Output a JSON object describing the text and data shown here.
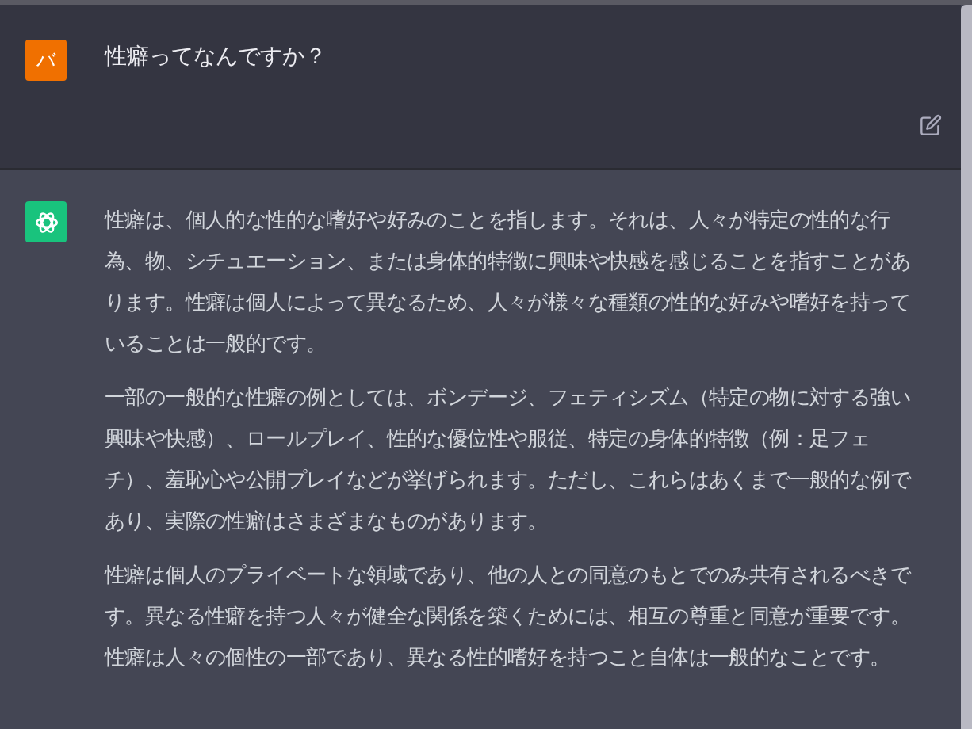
{
  "conversation": [
    {
      "kind": "user",
      "avatar": "バ",
      "text": "性癖ってなんですか？"
    },
    {
      "kind": "assistant",
      "paragraphs": [
        "性癖は、個人的な性的な嗜好や好みのことを指します。それは、人々が特定の性的な行為、物、シチュエーション、または身体的特徴に興味や快感を感じることを指すことがあります。性癖は個人によって異なるため、人々が様々な種類の性的な好みや嗜好を持っていることは一般的です。",
        "一部の一般的な性癖の例としては、ボンデージ、フェティシズム（特定の物に対する強い興味や快感）、ロールプレイ、性的な優位性や服従、特定の身体的特徴（例：足フェチ）、羞恥心や公開プレイなどが挙げられます。ただし、これらはあくまで一般的な例であり、実際の性癖はさまざまなものがあります。",
        "性癖は個人のプライベートな領域であり、他の人との同意のもとでのみ共有されるべきです。異なる性癖を持つ人々が健全な関係を築くためには、相互の尊重と同意が重要です。性癖は人々の個性の一部であり、異なる性的嗜好を持つこと自体は一般的なことです。"
      ]
    }
  ]
}
